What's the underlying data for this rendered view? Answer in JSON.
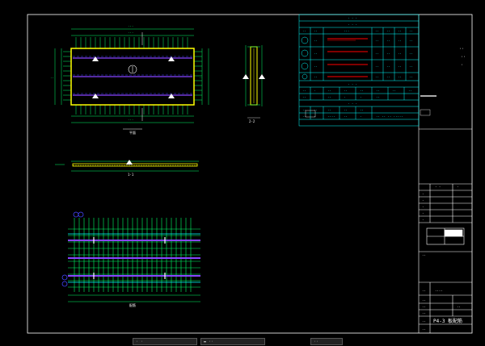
{
  "drawing": {
    "title_block": {
      "sheet_code": "P4-3 板配筋",
      "page_mark": "4"
    },
    "views": {
      "plan_top": {
        "label": "平面"
      },
      "section_mid": {
        "label": "1-1"
      },
      "side_view": {
        "label": "2-2"
      },
      "rebar_view": {
        "label": "配筋"
      }
    },
    "colors": {
      "background": "#000000",
      "frame": "#ffffff",
      "rebar": "#00ff66",
      "concrete": "#ffff00",
      "table_lines": "#00ffff",
      "accent_blue": "#4444ff",
      "accent_red": "#ff0000",
      "accent_purple": "#aa66ff"
    }
  },
  "taskbar": {
    "items": [
      {
        "label": "· ·"
      },
      {
        "label": "▬ ··"
      },
      {
        "label": "··"
      }
    ]
  }
}
